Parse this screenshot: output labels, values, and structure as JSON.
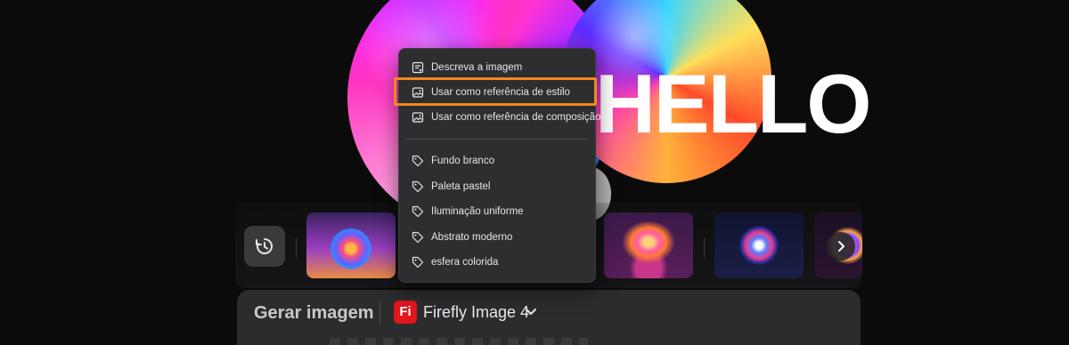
{
  "hero": {
    "text": "HELLO"
  },
  "context_menu": {
    "items": [
      {
        "label": "Descreva a imagem",
        "icon": "describe-image-icon"
      },
      {
        "label": "Usar como referência de estilo",
        "icon": "image-icon",
        "highlighted": true
      },
      {
        "label": "Usar como referência de composição",
        "icon": "image-icon"
      }
    ],
    "tags": [
      {
        "label": "Fundo branco",
        "icon": "tag-icon"
      },
      {
        "label": "Paleta pastel",
        "icon": "tag-icon"
      },
      {
        "label": "Iluminação uniforme",
        "icon": "tag-icon"
      },
      {
        "label": "Abstrato moderno",
        "icon": "tag-icon"
      },
      {
        "label": "esfera colorida",
        "icon": "tag-icon"
      }
    ],
    "highlight_color": "#f08a1c"
  },
  "strip": {
    "history_icon": "history-icon",
    "next_icon": "chevron-right-icon"
  },
  "panel": {
    "title": "Gerar imagem",
    "model_logo": "Fi",
    "model_name": "Firefly Image 4",
    "model_chevron": "chevron-down-icon",
    "logo_color": "#e0161e"
  }
}
